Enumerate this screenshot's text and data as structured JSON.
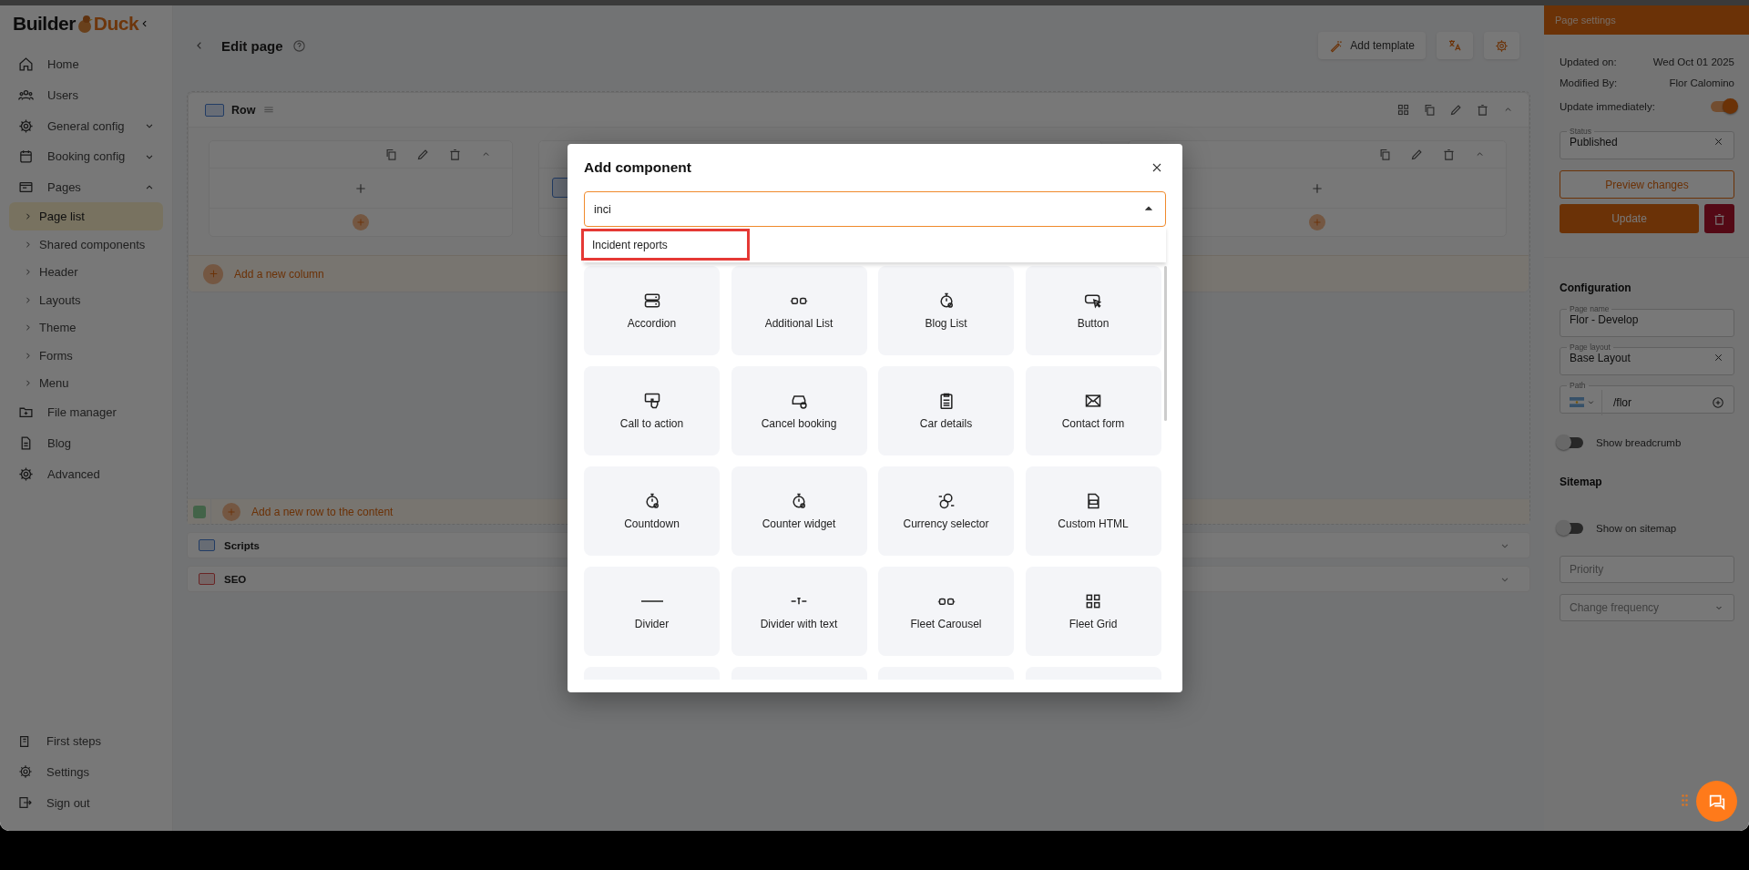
{
  "logo": {
    "left": "Builder",
    "right": "Duck"
  },
  "sidebar": {
    "items": [
      {
        "label": "Home",
        "selected": false
      },
      {
        "label": "Users",
        "selected": false
      },
      {
        "label": "General config",
        "selected": false,
        "expanded": false
      },
      {
        "label": "Booking config",
        "selected": false,
        "expanded": false
      },
      {
        "label": "Pages",
        "selected": false,
        "expanded": true,
        "children": [
          {
            "label": "Page list",
            "selected": true
          },
          {
            "label": "Shared components",
            "selected": false
          },
          {
            "label": "Header",
            "selected": false
          },
          {
            "label": "Layouts",
            "selected": false
          },
          {
            "label": "Theme",
            "selected": false
          },
          {
            "label": "Forms",
            "selected": false
          },
          {
            "label": "Menu",
            "selected": false
          }
        ]
      },
      {
        "label": "File manager",
        "selected": false
      },
      {
        "label": "Blog",
        "selected": false
      },
      {
        "label": "Advanced",
        "selected": false
      }
    ],
    "footer": [
      {
        "label": "First steps"
      },
      {
        "label": "Settings"
      },
      {
        "label": "Sign out"
      }
    ]
  },
  "header": {
    "title": "Edit page",
    "add_template": "Add template"
  },
  "row": {
    "label": "Row",
    "add_column": "Add a new column",
    "add_row": "Add a new row to the content"
  },
  "sections": [
    {
      "label": "Scripts",
      "kind": "code"
    },
    {
      "label": "SEO",
      "kind": "search"
    }
  ],
  "modal": {
    "title": "Add component",
    "search": {
      "value": "inci"
    },
    "options": [
      {
        "label": "Incident reports",
        "marked": true
      }
    ],
    "tiles": [
      {
        "kind": "tile",
        "label": "Accordion"
      },
      {
        "kind": "tile",
        "label": "Additional List"
      },
      {
        "kind": "tile",
        "label": "Blog List"
      },
      {
        "kind": "tile",
        "label": "Button"
      },
      {
        "kind": "tile",
        "label": "Call to action"
      },
      {
        "kind": "tile",
        "label": "Cancel booking"
      },
      {
        "kind": "tile",
        "label": "Car details"
      },
      {
        "kind": "tile",
        "label": "Contact form"
      },
      {
        "kind": "tile",
        "label": "Countdown"
      },
      {
        "kind": "tile",
        "label": "Counter widget"
      },
      {
        "kind": "tile",
        "label": "Currency selector"
      },
      {
        "kind": "tile",
        "label": "Custom HTML"
      },
      {
        "kind": "tile",
        "label": "Divider"
      },
      {
        "kind": "tile",
        "label": "Divider with text"
      },
      {
        "kind": "tile",
        "label": "Fleet Carousel"
      },
      {
        "kind": "tile",
        "label": "Fleet Grid"
      },
      {
        "kind": "cut"
      },
      {
        "kind": "cut"
      },
      {
        "kind": "cut"
      },
      {
        "kind": "cut"
      }
    ]
  },
  "settings": {
    "title": "Page settings",
    "meta": [
      {
        "label": "Updated on:",
        "value": "Wed Oct 01 2025"
      },
      {
        "label": "Modified By:",
        "value": "Flor Calomino"
      }
    ],
    "update_immediately": {
      "label": "Update immediately:",
      "on": true
    },
    "status": {
      "label": "Status",
      "value": "Published"
    },
    "preview": "Preview changes",
    "update": "Update",
    "configuration": "Configuration",
    "page_name": {
      "label": "Page name",
      "value": "Flor - Develop"
    },
    "page_layout": {
      "label": "Page layout",
      "value": "Base Layout"
    },
    "path": {
      "label": "Path",
      "value": "/flor"
    },
    "show_breadcrumb": {
      "label": "Show breadcrumb",
      "on": false
    },
    "sitemap": "Sitemap",
    "show_on_sitemap": {
      "label": "Show on sitemap",
      "on": false
    },
    "priority": {
      "placeholder": "Priority"
    },
    "change_frequency": {
      "placeholder": "Change frequency"
    }
  }
}
